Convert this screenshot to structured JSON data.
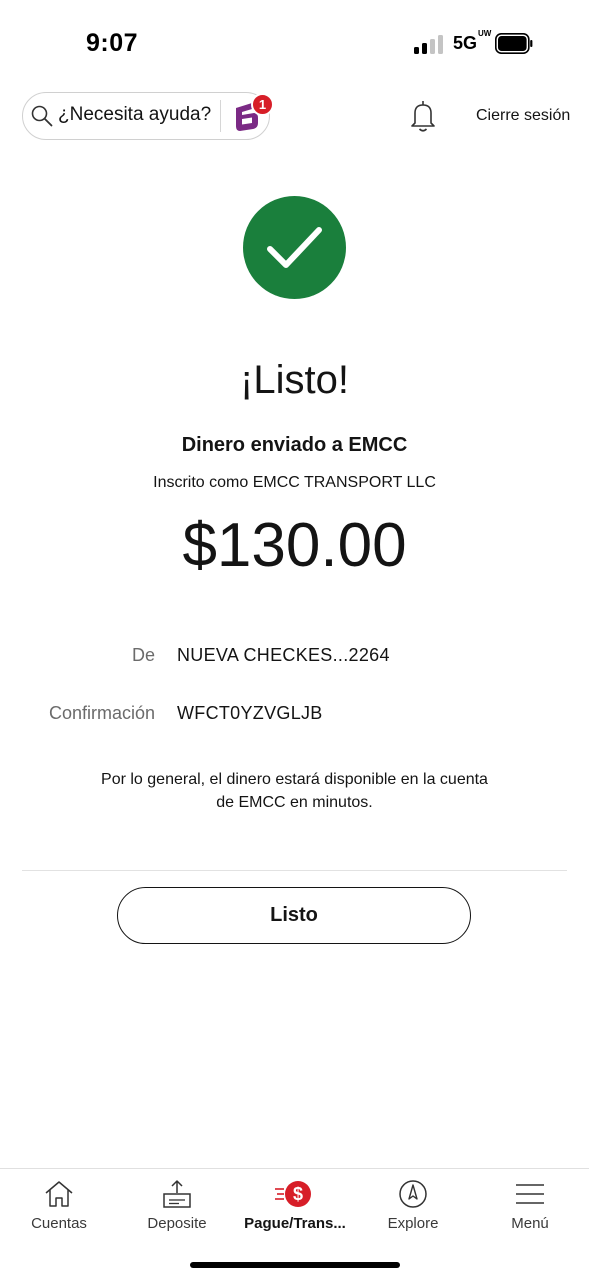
{
  "status_bar": {
    "time": "9:07",
    "network": "5G",
    "network_suffix": "UW",
    "signal_bars_active": 2,
    "signal_bars_total": 4
  },
  "header": {
    "help_placeholder": "¿Necesita ayuda?",
    "notification_count": "1",
    "logout_label": "Cierre sesión"
  },
  "confirmation": {
    "title": "¡Listo!",
    "subtitle": "Dinero enviado a EMCC",
    "enrolled_as": "Inscrito como EMCC TRANSPORT LLC",
    "amount": "$130.00",
    "details": [
      {
        "label": "De",
        "value": "NUEVA CHECKES...2264"
      },
      {
        "label": "Confirmación",
        "value": "WFCT0YZVGLJB"
      }
    ],
    "note_line1": "Por lo general, el dinero estará disponible en la cuenta",
    "note_line2": "de EMCC en minutos.",
    "done_button": "Listo"
  },
  "bottom_nav": {
    "items": [
      {
        "label": "Cuentas",
        "icon": "home-icon"
      },
      {
        "label": "Deposite",
        "icon": "deposit-icon"
      },
      {
        "label": "Pague/Trans...",
        "icon": "pay-transfer-icon",
        "active": true
      },
      {
        "label": "Explore",
        "icon": "compass-icon"
      },
      {
        "label": "Menú",
        "icon": "menu-icon"
      }
    ]
  },
  "colors": {
    "success_green": "#1a7f3c",
    "brand_red": "#d71e28",
    "fargo_purple": "#7b2a85"
  }
}
